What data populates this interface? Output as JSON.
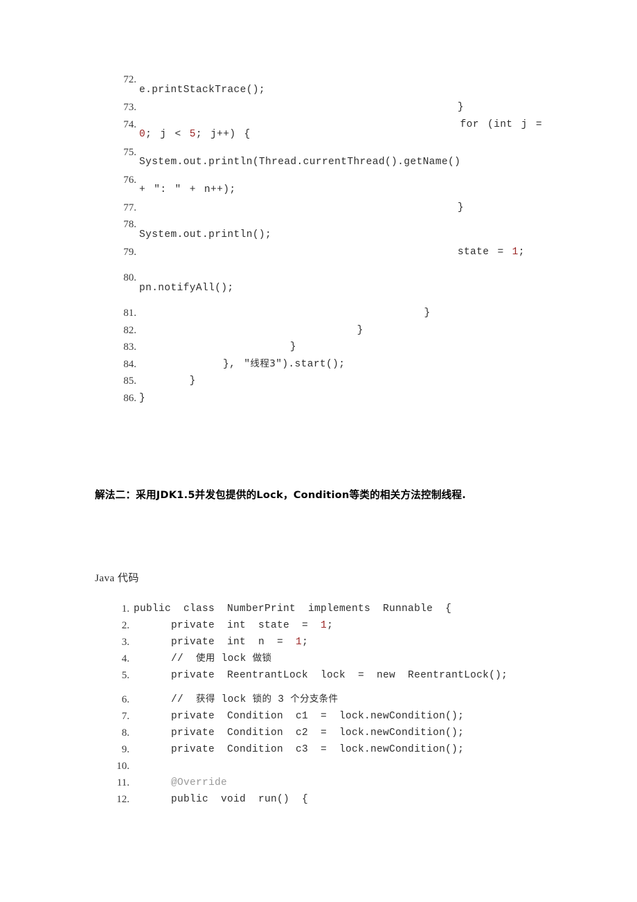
{
  "document": {
    "background_color": "#ffffff",
    "text_color": "#2e2e2e",
    "literal_color": "#9b2524",
    "annotation_color": "#9a9a9a"
  },
  "listing_top": {
    "name": "java-code-listing-part1",
    "lines": [
      {
        "number": "72.",
        "code": "                                          e.printStackTrace();"
      },
      {
        "number": "73.",
        "code": "                                      }"
      },
      {
        "number": "74.",
        "code": "                                      for (int j = 0; j < 5; j++) {"
      },
      {
        "number": "75.",
        "code": "                                          System.out.println(Thread.currentThread().getName()"
      },
      {
        "number": "76.",
        "code": "                                                  + \": \" + n++);"
      },
      {
        "number": "77.",
        "code": "                                      }"
      },
      {
        "number": "78.",
        "code": "                                      System.out.println();"
      },
      {
        "number": "79.",
        "code": "                                      state = 1;"
      },
      {
        "number": "80.",
        "code": "                                      pn.notifyAll();"
      },
      {
        "number": "81.",
        "code": "                                  }"
      },
      {
        "number": "82.",
        "code": "                          }"
      },
      {
        "number": "83.",
        "code": "                  }"
      },
      {
        "number": "84.",
        "code": "          }, \"线程3\").start();"
      },
      {
        "number": "85.",
        "code": "      }"
      },
      {
        "number": "86.",
        "code": "}"
      }
    ]
  },
  "section_heading": {
    "name": "solution-two-heading",
    "text": "解法二：采用JDK1.5并发包提供的Lock，Condition等类的相关方法控制线程."
  },
  "code_caption": {
    "name": "java-code-caption",
    "text": "Java 代码"
  },
  "listing_bottom": {
    "name": "java-code-listing-part2",
    "lines": [
      {
        "number": "1.",
        "code": "public class NumberPrint implements Runnable {"
      },
      {
        "number": "2.",
        "code": "        private int state = 1;"
      },
      {
        "number": "3.",
        "code": "        private int n = 1;"
      },
      {
        "number": "4.",
        "code": "        // 使用 lock 做锁"
      },
      {
        "number": "5.",
        "code": "        private ReentrantLock lock = new ReentrantLock();"
      },
      {
        "number": "6.",
        "code": "        // 获得 lock 锁的 3 个分支条件"
      },
      {
        "number": "7.",
        "code": "        private Condition c1 = lock.newCondition();"
      },
      {
        "number": "8.",
        "code": "        private Condition c2 = lock.newCondition();"
      },
      {
        "number": "9.",
        "code": "        private Condition c3 = lock.newCondition();"
      },
      {
        "number": "10.",
        "code": ""
      },
      {
        "number": "11.",
        "code": "        @Override"
      },
      {
        "number": "12.",
        "code": "        public void run() {"
      }
    ]
  }
}
